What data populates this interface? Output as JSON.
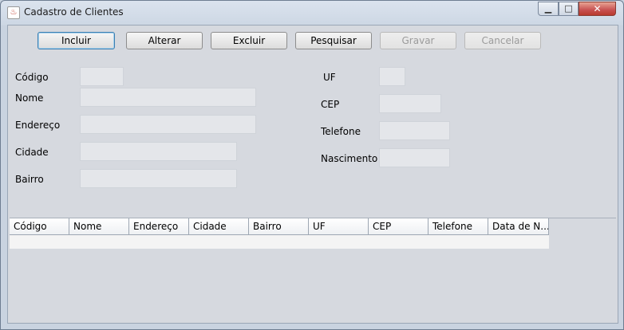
{
  "window": {
    "title": "Cadastro de Clientes",
    "icon": "java-coffee-icon",
    "controls": {
      "minimize": "minimize-icon",
      "maximize": "maximize-icon",
      "close": "close-icon"
    }
  },
  "toolbar": {
    "incluir": "Incluir",
    "alterar": "Alterar",
    "excluir": "Excluir",
    "pesquisar": "Pesquisar",
    "gravar": "Gravar",
    "cancelar": "Cancelar"
  },
  "form": {
    "codigo": {
      "label": "Código",
      "value": ""
    },
    "nome": {
      "label": "Nome",
      "value": ""
    },
    "endereco": {
      "label": "Endereço",
      "value": ""
    },
    "cidade": {
      "label": "Cidade",
      "value": ""
    },
    "bairro": {
      "label": "Bairro",
      "value": ""
    },
    "uf": {
      "label": "UF",
      "value": ""
    },
    "cep": {
      "label": "CEP",
      "value": ""
    },
    "telefone": {
      "label": "Telefone",
      "value": ""
    },
    "nascimento": {
      "label": "Nascimento",
      "value": ""
    }
  },
  "table": {
    "columns": [
      "Código",
      "Nome",
      "Endereço",
      "Cidade",
      "Bairro",
      "UF",
      "CEP",
      "Telefone",
      "Data de N..."
    ],
    "rows": [
      []
    ]
  }
}
